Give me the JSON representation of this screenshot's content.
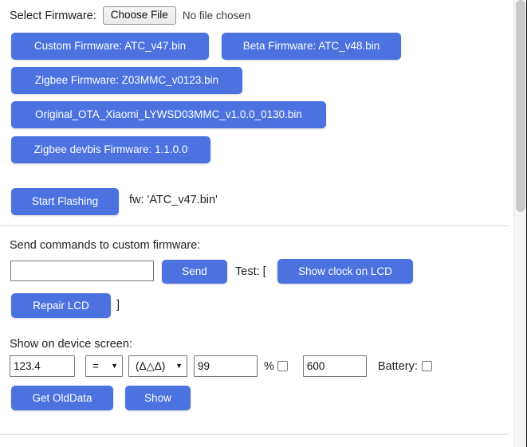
{
  "firmware_section": {
    "select_label": "Select Firmware:",
    "choose_file_button": "Choose File",
    "file_status": "No file chosen",
    "buttons": [
      {
        "id": "custom",
        "label": "Custom Firmware: ATC_v47.bin"
      },
      {
        "id": "beta",
        "label": "Beta Firmware: ATC_v48.bin"
      },
      {
        "id": "zigbee",
        "label": "Zigbee Firmware: Z03MMC_v0123.bin"
      },
      {
        "id": "original",
        "label": "Original_OTA_Xiaomi_LYWSD03MMC_v1.0.0_0130.bin"
      },
      {
        "id": "devbis",
        "label": "Zigbee devbis Firmware: 1.1.0.0"
      }
    ],
    "start_flashing_button": "Start Flashing",
    "firmware_info": "fw: 'ATC_v47.bin'"
  },
  "commands_section": {
    "title": "Send commands to custom firmware:",
    "command_input_value": "",
    "command_input_placeholder": "",
    "send_button": "Send",
    "test_label_open": "Test: [",
    "show_clock_button": "Show clock on LCD",
    "repair_lcd_button": "Repair LCD",
    "test_label_close": "]"
  },
  "device_screen_section": {
    "title": "Show on device screen:",
    "value_input": "123.4",
    "operator_select": "=",
    "operator_options": [
      "=",
      ">",
      "<"
    ],
    "unit_select": "(Δ△Δ)",
    "unit_options": [
      "(Δ△Δ)"
    ],
    "percent_input": "99",
    "percent_label": "%",
    "percent_checkbox_checked": false,
    "millis_input": "600",
    "battery_label": "Battery:",
    "battery_checkbox_checked": false,
    "get_old_data_button": "Get OldData",
    "show_button": "Show"
  },
  "scrollbar": {
    "orientation": "vertical"
  },
  "colors": {
    "accent_blue": "#4c72e0",
    "text": "#1f1f1f",
    "page_background": "#ffffff",
    "divider": "#e3e3e3",
    "scrollbar_thumb": "#c9c9c9"
  }
}
